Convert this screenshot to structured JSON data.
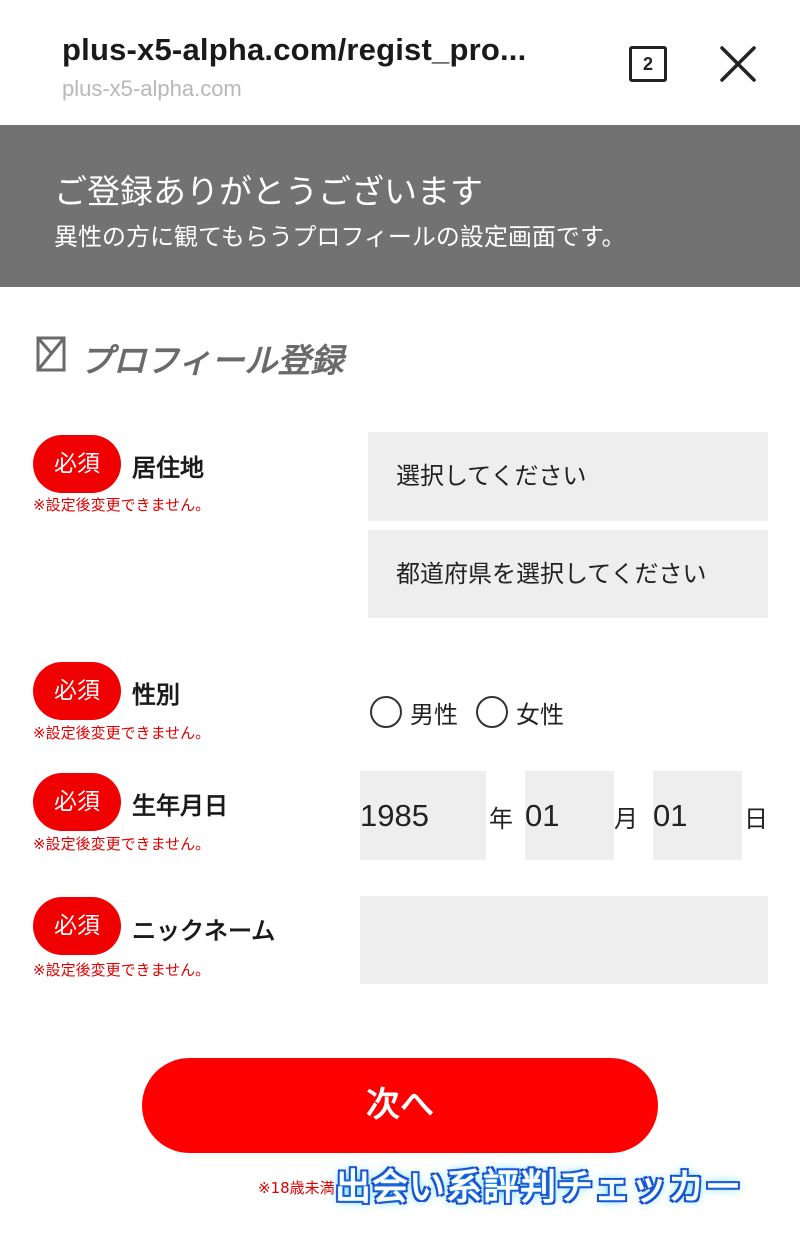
{
  "browser": {
    "url": "plus-x5-alpha.com/regist_pro...",
    "domain": "plus-x5-alpha.com",
    "tab_count": "2"
  },
  "banner": {
    "title": "ご登録ありがとうございます",
    "subtitle": "異性の方に観てもらうプロフィールの設定画面です。"
  },
  "section": {
    "title": "プロフィール登録"
  },
  "form": {
    "required_badge": "必須",
    "note": "※設定後変更できません。",
    "residence": {
      "label": "居住地",
      "select1": "選択してください",
      "select2": "都道府県を選択してください"
    },
    "gender": {
      "label": "性別",
      "options": [
        "男性",
        "女性"
      ]
    },
    "birthday": {
      "label": "生年月日",
      "year": "1985",
      "year_unit": "年",
      "month": "01",
      "month_unit": "月",
      "day": "01",
      "day_unit": "日"
    },
    "nickname": {
      "label": "ニックネーム",
      "value": ""
    },
    "next_button": "次へ",
    "footnote": "※18歳未満"
  },
  "watermark": "出会い系評判チェッカー",
  "colors": {
    "banner_bg": "#727272",
    "accent_red": "#ff0000",
    "field_bg": "#eeeeee"
  }
}
